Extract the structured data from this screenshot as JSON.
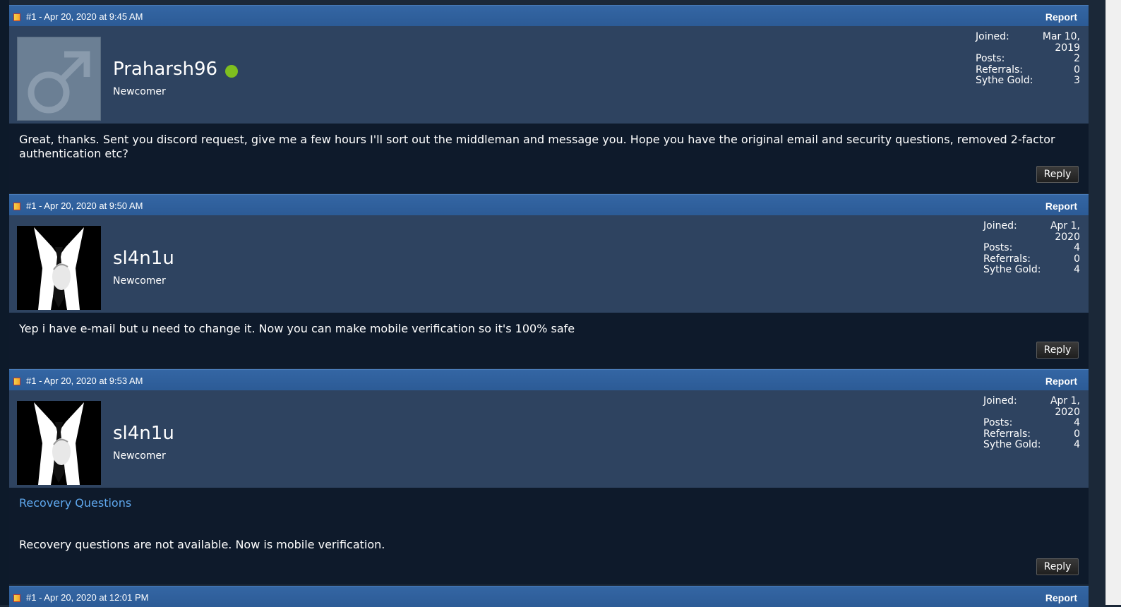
{
  "posts": [
    {
      "header": "#1 - Apr 20, 2020 at 9:45 AM",
      "report_label": "Report",
      "username": "Praharsh96",
      "online": true,
      "rank": "Newcomer",
      "avatar": "default-male-avatar",
      "stats": {
        "joined_label": "Joined:",
        "joined": "Mar 10, 2019",
        "posts_label": "Posts:",
        "posts": "2",
        "referrals_label": "Referrals:",
        "referrals": "0",
        "gold_label": "Sythe Gold:",
        "gold": "3"
      },
      "message": "Great, thanks. Sent you discord request, give me a few hours I'll sort out the middleman and message you. Hope you have the original email and security questions, removed 2-factor authentication etc?",
      "reply_label": "Reply"
    },
    {
      "header": "#1 - Apr 20, 2020 at 9:50 AM",
      "report_label": "Report",
      "username": "sl4n1u",
      "online": false,
      "rank": "Newcomer",
      "avatar": "suit-tie-avatar",
      "stats": {
        "joined_label": "Joined:",
        "joined": "Apr 1, 2020",
        "posts_label": "Posts:",
        "posts": "4",
        "referrals_label": "Referrals:",
        "referrals": "0",
        "gold_label": "Sythe Gold:",
        "gold": "4"
      },
      "message": "Yep i have e-mail but u need to change it. Now you can make mobile verification so it's 100% safe",
      "reply_label": "Reply"
    },
    {
      "header": "#1 - Apr 20, 2020 at 9:53 AM",
      "report_label": "Report",
      "username": "sl4n1u",
      "online": false,
      "rank": "Newcomer",
      "avatar": "suit-tie-avatar",
      "stats": {
        "joined_label": "Joined:",
        "joined": "Apr 1, 2020",
        "posts_label": "Posts:",
        "posts": "4",
        "referrals_label": "Referrals:",
        "referrals": "0",
        "gold_label": "Sythe Gold:",
        "gold": "4"
      },
      "link_heading": "Recovery Questions",
      "message": "Recovery questions are not available. Now is mobile verification.",
      "reply_label": "Reply"
    },
    {
      "header": "#1 - Apr 20, 2020 at 12:01 PM",
      "report_label": "Report"
    }
  ]
}
